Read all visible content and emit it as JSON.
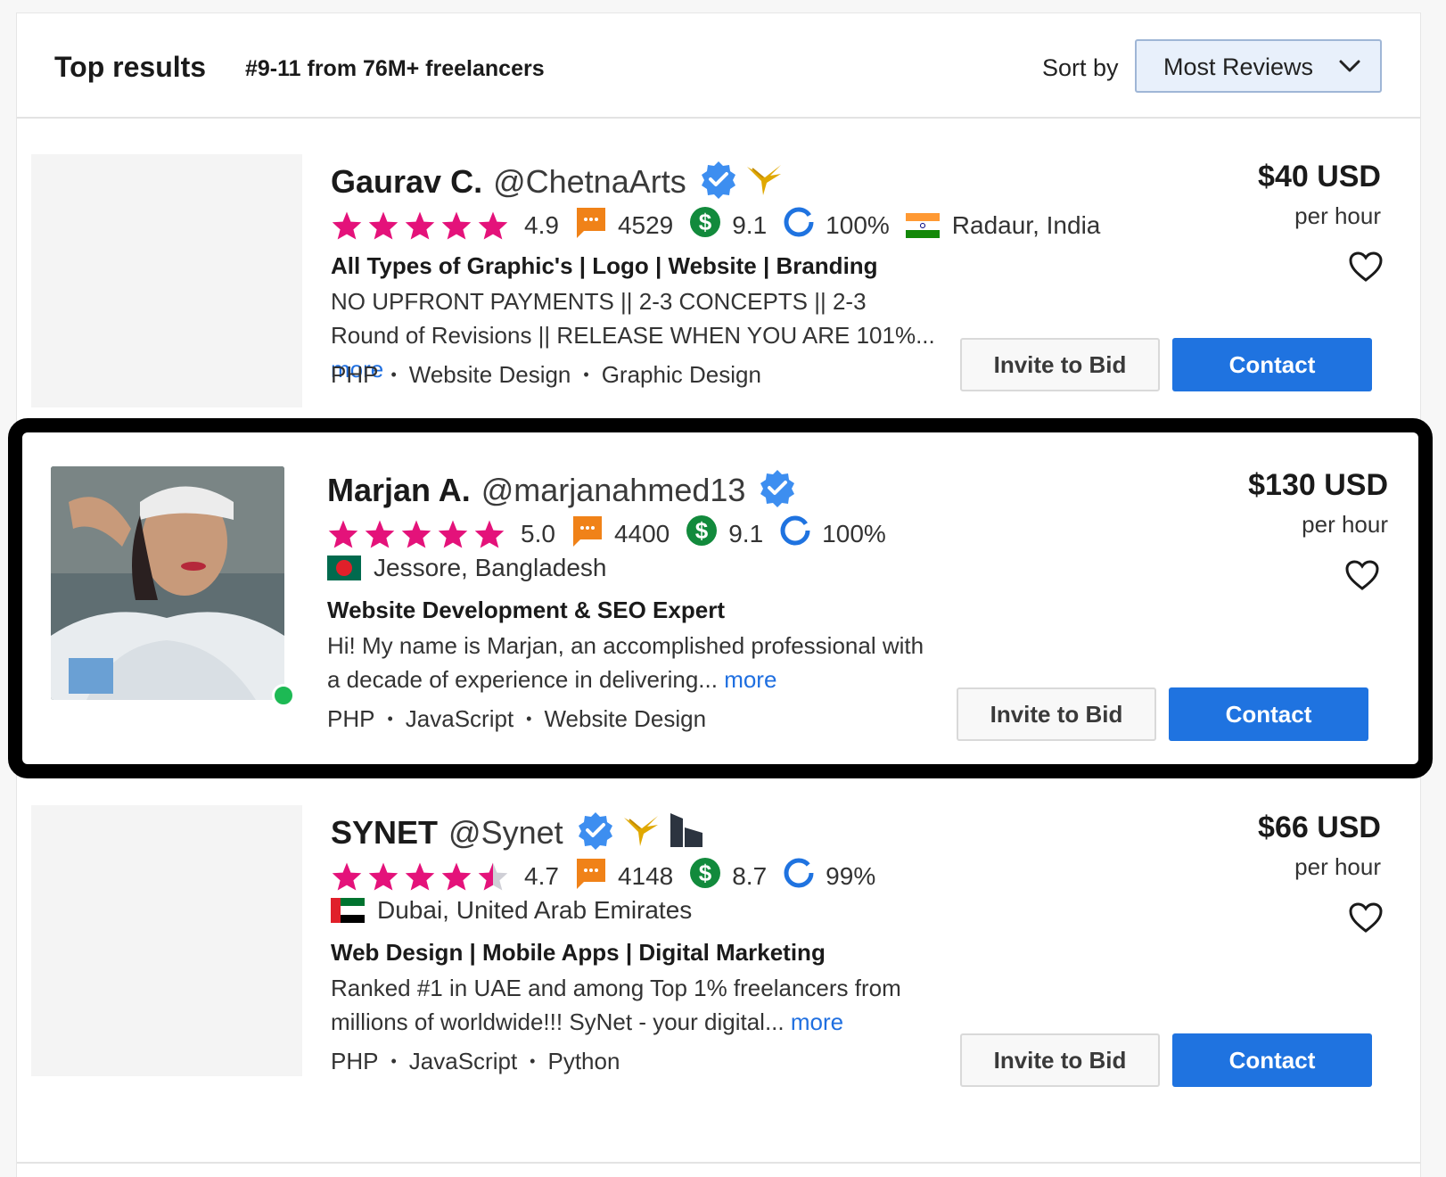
{
  "header": {
    "title": "Top results",
    "count_text": "#9-11 from 76M+ freelancers",
    "sort_label": "Sort by",
    "sort_value": "Most Reviews"
  },
  "colors": {
    "star": "#e4127a",
    "review_icon": "#f08218",
    "earnings_icon": "#128a3c",
    "completion_ring": "#1f73e0",
    "verified": "#3d8ef0",
    "contact_button": "#1f73e0",
    "link": "#1f6fe0"
  },
  "freelancers": [
    {
      "name": "Gaurav C.",
      "handle": "@ChetnaArts",
      "badges": [
        "verified-icon",
        "preferred-freelancer-icon"
      ],
      "rating": "4.9",
      "rating_stars": 4.9,
      "reviews": "4529",
      "earnings_score": "9.1",
      "completion": "100%",
      "location": "Radaur, India",
      "flag": "india-flag-icon",
      "tagline": "All Types of Graphic's | Logo | Website | Branding",
      "description": "NO UPFRONT PAYMENTS || 2-3 CONCEPTS || 2-3 Round of Revisions || RELEASE WHEN YOU ARE 101%...",
      "more": "more",
      "skills": [
        "PHP",
        "Website Design",
        "Graphic Design"
      ],
      "price": "$40 USD",
      "per": "per hour",
      "invite_label": "Invite to Bid",
      "contact_label": "Contact"
    },
    {
      "name": "Marjan A.",
      "handle": "@marjanahmed13",
      "badges": [
        "verified-icon"
      ],
      "rating": "5.0",
      "rating_stars": 5.0,
      "reviews": "4400",
      "earnings_score": "9.1",
      "completion": "100%",
      "location": "Jessore, Bangladesh",
      "flag": "bangladesh-flag-icon",
      "online": true,
      "tagline": "Website Development & SEO Expert",
      "description": "Hi! My name is Marjan, an accomplished professional with a decade of experience in delivering...",
      "more": "more",
      "skills": [
        "PHP",
        "JavaScript",
        "Website Design"
      ],
      "price": "$130 USD",
      "per": "per hour",
      "invite_label": "Invite to Bid",
      "contact_label": "Contact"
    },
    {
      "name": "SYNET",
      "handle": "@Synet",
      "badges": [
        "verified-icon",
        "preferred-freelancer-icon",
        "enterprise-icon"
      ],
      "rating": "4.7",
      "rating_stars": 4.7,
      "reviews": "4148",
      "earnings_score": "8.7",
      "completion": "99%",
      "location": "Dubai, United Arab Emirates",
      "flag": "uae-flag-icon",
      "tagline": "Web Design | Mobile Apps | Digital Marketing",
      "description": "Ranked #1 in UAE and among Top 1% freelancers from millions of worldwide!!! SyNet - your digital...",
      "more": "more",
      "skills": [
        "PHP",
        "JavaScript",
        "Python"
      ],
      "price": "$66 USD",
      "per": "per hour",
      "invite_label": "Invite to Bid",
      "contact_label": "Contact"
    }
  ]
}
